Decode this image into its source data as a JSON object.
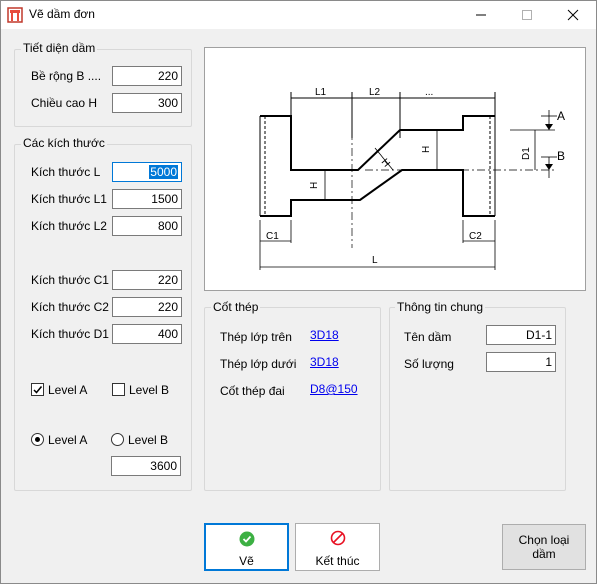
{
  "window": {
    "title": "Vẽ dầm đơn",
    "minimize_symbol": "—",
    "close_symbol": "✕"
  },
  "section_size": {
    "title": "Tiết diện dầm",
    "width_label": "Bề rộng B ....",
    "width_value": "220",
    "height_label": "Chiều cao H",
    "height_value": "300"
  },
  "dimensions": {
    "title": "Các kích thước",
    "L_label": "Kích thước L",
    "L_value": "5000",
    "L1_label": "Kích thước L1",
    "L1_value": "1500",
    "L2_label": "Kích thước L2",
    "L2_value": "800",
    "C1_label": "Kích thước C1",
    "C1_value": "220",
    "C2_label": "Kích thước C2",
    "C2_value": "220",
    "D1_label": "Kích thước D1",
    "D1_value": "400",
    "check_level_a": "Level A",
    "check_level_a_checked": true,
    "check_level_b": "Level B",
    "check_level_b_checked": false,
    "radio_level_a": "Level A",
    "radio_level_b": "Level B",
    "radio_selected": "Level A",
    "level_value": "3600"
  },
  "drawing": {
    "labels": {
      "L1": "L1",
      "L2": "L2",
      "dots": "...",
      "A": "A",
      "B": "B",
      "D1": "D1",
      "H": "H",
      "C1": "C1",
      "C2": "C2",
      "L": "L"
    }
  },
  "rebar": {
    "title": "Cốt thép",
    "top_label": "Thép lớp trên",
    "top_value": "3D18",
    "bottom_label": "Thép lớp dưới",
    "bottom_value": "3D18",
    "stirrup_label": "Cốt thép đai",
    "stirrup_value": "D8@150"
  },
  "general": {
    "title": "Thông tin chung",
    "name_label": "Tên dầm",
    "name_value": "D1-1",
    "count_label": "Số lượng",
    "count_value": "1"
  },
  "buttons": {
    "draw": "Vẽ",
    "exit": "Kết thúc",
    "choose_type": "Chọn loại dầm"
  },
  "colors": {
    "accent": "#0078d7",
    "ok_green": "#3cb043",
    "exit_red": "#e81123",
    "link": "#0000ee"
  }
}
